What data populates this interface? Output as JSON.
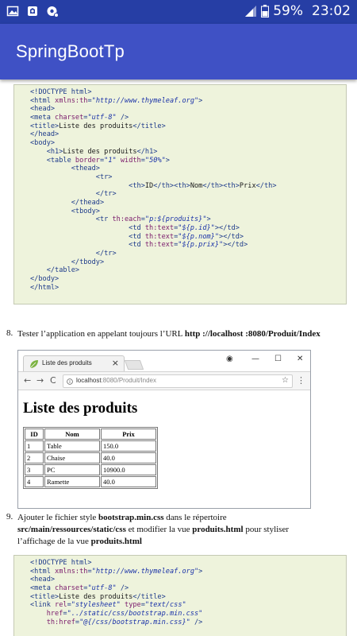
{
  "status_bar": {
    "icons": [
      "image-icon",
      "photo-app-icon",
      "settings-notification-icon"
    ],
    "battery": "59%",
    "time": "23:02"
  },
  "app_bar": {
    "title": "SpringBootTp"
  },
  "code_block_1": [
    [
      [
        "tag",
        "<!DOCTYPE html>"
      ]
    ],
    [
      [
        "tag",
        "<html "
      ],
      [
        "attr",
        "xmlns:th"
      ],
      [
        "tag",
        "="
      ],
      [
        "str",
        "\"http://www.thymeleaf.org\""
      ],
      [
        "tag",
        ">"
      ]
    ],
    [
      [
        "tag",
        "<head>"
      ]
    ],
    [
      [
        "tag",
        "<meta "
      ],
      [
        "attr",
        "charset"
      ],
      [
        "tag",
        "="
      ],
      [
        "str",
        "\"utf-8\""
      ],
      [
        "tag",
        " />"
      ]
    ],
    [
      [
        "tag",
        "<title>"
      ],
      [
        "txt",
        "Liste des produits"
      ],
      [
        "tag",
        "</title>"
      ]
    ],
    [
      [
        "tag",
        "</head>"
      ]
    ],
    [
      [
        "tag",
        "<body>"
      ]
    ],
    [
      [
        "tag",
        "    <h1>"
      ],
      [
        "txt",
        "Liste des produits"
      ],
      [
        "tag",
        "</h1>"
      ]
    ],
    [
      [
        "tag",
        "    <table "
      ],
      [
        "attr",
        "border"
      ],
      [
        "tag",
        "="
      ],
      [
        "str",
        "\"1\""
      ],
      [
        "attr",
        " width"
      ],
      [
        "tag",
        "="
      ],
      [
        "str",
        "\"50%\""
      ],
      [
        "tag",
        ">"
      ]
    ],
    [
      [
        "tag",
        "          <thead>"
      ]
    ],
    [
      [
        "tag",
        "                <tr>"
      ]
    ],
    [
      [
        "tag",
        "                        <th>"
      ],
      [
        "txt",
        "ID"
      ],
      [
        "tag",
        "</th><th>"
      ],
      [
        "txt",
        "Nom"
      ],
      [
        "tag",
        "</th><th>"
      ],
      [
        "txt",
        "Prix"
      ],
      [
        "tag",
        "</th>"
      ]
    ],
    [
      [
        "tag",
        "                </tr>"
      ]
    ],
    [
      [
        "tag",
        "          </thead>"
      ]
    ],
    [
      [
        "tag",
        "          <tbody>"
      ]
    ],
    [
      [
        "tag",
        "                <tr "
      ],
      [
        "attr",
        "th:each"
      ],
      [
        "tag",
        "="
      ],
      [
        "str",
        "\"p:${produits}\""
      ],
      [
        "tag",
        ">"
      ]
    ],
    [
      [
        "tag",
        "                        <td "
      ],
      [
        "attr",
        "th:text"
      ],
      [
        "tag",
        "="
      ],
      [
        "str",
        "\"${p.id}\""
      ],
      [
        "tag",
        "></td>"
      ]
    ],
    [
      [
        "tag",
        "                        <td "
      ],
      [
        "attr",
        "th:text"
      ],
      [
        "tag",
        "="
      ],
      [
        "str",
        "\"${p.nom}\""
      ],
      [
        "tag",
        "></td>"
      ]
    ],
    [
      [
        "tag",
        "                        <td "
      ],
      [
        "attr",
        "th:text"
      ],
      [
        "tag",
        "="
      ],
      [
        "str",
        "\"${p.prix}\""
      ],
      [
        "tag",
        "></td>"
      ]
    ],
    [
      [
        "tag",
        "                </tr>"
      ]
    ],
    [
      [
        "tag",
        "          </tbody>"
      ]
    ],
    [
      [
        "tag",
        "    </table>"
      ]
    ],
    [
      [
        "tag",
        "</body>"
      ]
    ],
    [
      [
        "tag",
        "</html>"
      ]
    ]
  ],
  "step8": {
    "number": "8.",
    "text_before": "Tester l’application en appelant toujours l’URL ",
    "url": "http ://localhost :8080/Produit/Index"
  },
  "browser": {
    "tab_title": "Liste des produits",
    "tab_close": "×",
    "win_account": "◉",
    "win_min": "—",
    "win_max": "☐",
    "win_close": "✕",
    "nav_back": "←",
    "nav_forward": "→",
    "nav_reload": "C",
    "url_host": "localhost",
    "url_rest": ":8080/Produit/Index",
    "star": "☆",
    "menu": "⋮",
    "page_heading": "Liste des produits",
    "table_headers": [
      "ID",
      "Nom",
      "Prix"
    ],
    "table_rows": [
      [
        "1",
        "Table",
        "150.0"
      ],
      [
        "2",
        "Chaise",
        "40.0"
      ],
      [
        "3",
        "PC",
        "10900.0"
      ],
      [
        "4",
        "Ramette",
        "40.0"
      ]
    ]
  },
  "step9": {
    "number": "9.",
    "line1_a": "Ajouter le fichier style ",
    "line1_b": "bootstrap.min.css",
    "line1_c": " dans le répertoire",
    "line2_a": "src/main/ressources/static/css",
    "line2_b": " et modifier la vue ",
    "line2_c": "produits.html",
    "line2_d": " pour styliser",
    "line3_a": "l’affichage de la vue ",
    "line3_b": "produits.html"
  },
  "code_block_2": [
    [
      [
        "tag",
        "<!DOCTYPE html>"
      ]
    ],
    [
      [
        "tag",
        "<html "
      ],
      [
        "attr",
        "xmlns:th"
      ],
      [
        "tag",
        "="
      ],
      [
        "str",
        "\"http://www.thymeleaf.org\""
      ],
      [
        "tag",
        ">"
      ]
    ],
    [
      [
        "tag",
        "<head>"
      ]
    ],
    [
      [
        "tag",
        "<meta "
      ],
      [
        "attr",
        "charset"
      ],
      [
        "tag",
        "="
      ],
      [
        "str",
        "\"utf-8\""
      ],
      [
        "tag",
        " />"
      ]
    ],
    [
      [
        "tag",
        "<title>"
      ],
      [
        "txt",
        "Liste des produits"
      ],
      [
        "tag",
        "</title>"
      ]
    ],
    [
      [
        "tag",
        "<link "
      ],
      [
        "attr",
        "rel"
      ],
      [
        "tag",
        "="
      ],
      [
        "str",
        "\"stylesheet\""
      ],
      [
        "attr",
        " type"
      ],
      [
        "tag",
        "="
      ],
      [
        "str",
        "\"text/css\""
      ]
    ],
    [
      [
        "attr",
        "    href"
      ],
      [
        "tag",
        "="
      ],
      [
        "str",
        "\"../static/css/bootstrap.min.css\""
      ]
    ],
    [
      [
        "attr",
        "    th:href"
      ],
      [
        "tag",
        "="
      ],
      [
        "str",
        "\"@{/css/bootstrap.min.css}\""
      ],
      [
        "tag",
        " />"
      ]
    ]
  ]
}
